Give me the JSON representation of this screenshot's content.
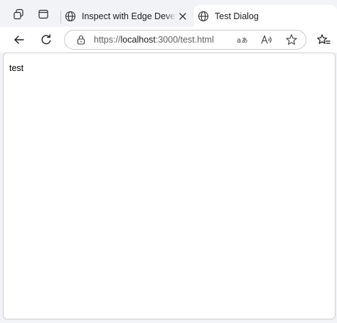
{
  "tabs": [
    {
      "title": "Inspect with Edge Developer",
      "icon": "globe-icon",
      "active": false
    },
    {
      "title": "Test Dialog",
      "icon": "globe-icon",
      "active": true
    }
  ],
  "address": {
    "scheme": "https://",
    "host": "localhost",
    "rest": ":3000/test.html"
  },
  "page": {
    "text": "test"
  },
  "icons": {
    "left_toolbar": [
      "workspaces-icon",
      "tab-actions-icon"
    ],
    "nav": [
      "back-icon",
      "refresh-icon"
    ],
    "address_actions": [
      "translate-icon",
      "read-aloud-icon",
      "favorite-star-icon",
      "favorites-icon"
    ]
  },
  "colors": {
    "frame": "#f1f3f6",
    "active_tab": "#ffffff",
    "text": "#1b1b1b",
    "url_muted": "#5f5f5f"
  }
}
